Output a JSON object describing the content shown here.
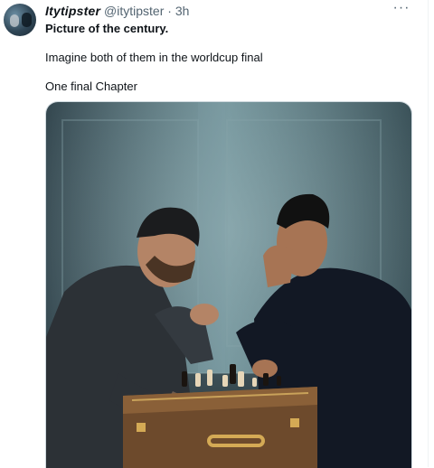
{
  "tweet": {
    "display_name": "Itytipster",
    "handle": "@itytipster",
    "separator": "·",
    "time": "3h",
    "more_label": "···",
    "lines": [
      "Picture of the century.",
      "Imagine both of them in the worldcup final",
      "One final Chapter"
    ]
  },
  "media": {
    "icon": "photo-chess-players",
    "colors": {
      "wall": "#5f7f86",
      "wall_dark": "#2e4048",
      "floor": "#33434a",
      "left_sweater": "#2b2f34",
      "right_sweater": "#11161f",
      "board_case": "#6d4a2c"
    }
  }
}
